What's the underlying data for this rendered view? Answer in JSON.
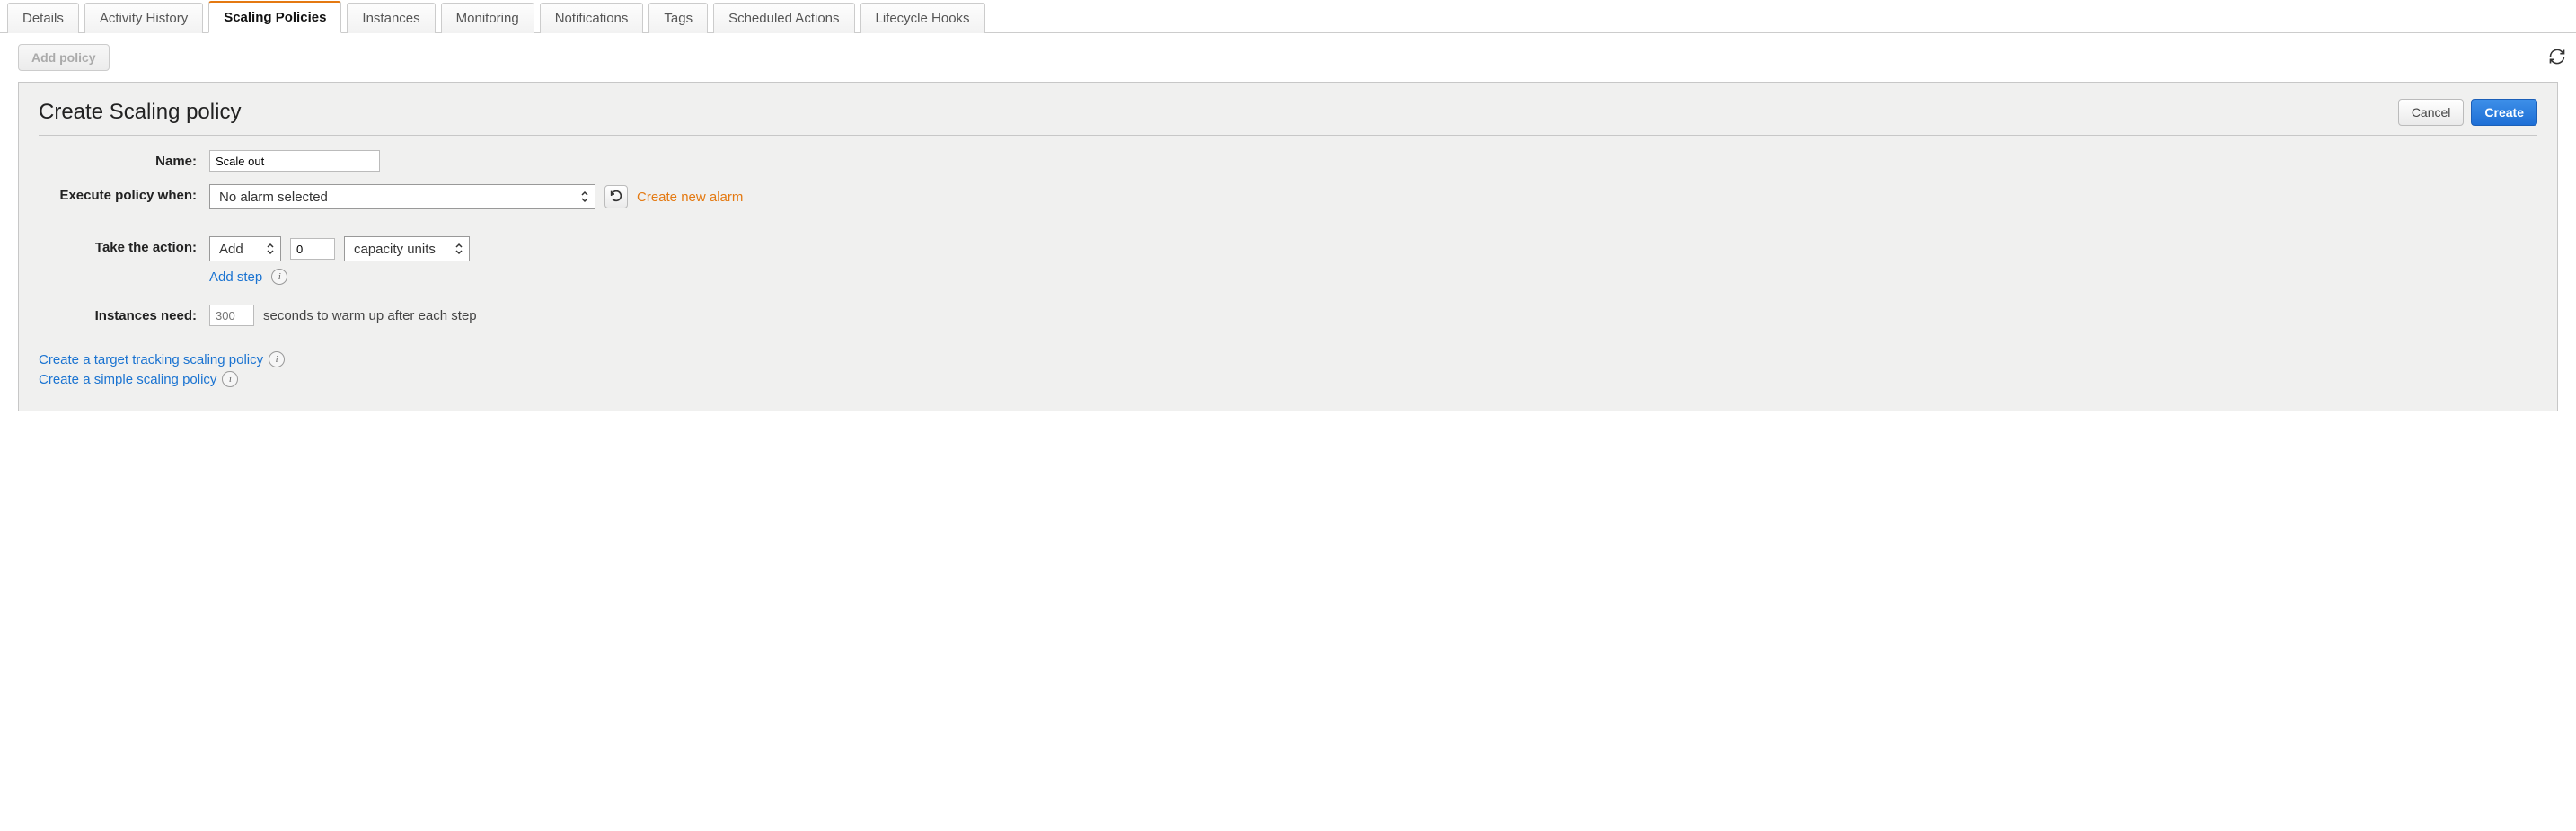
{
  "tabs": {
    "items": [
      {
        "label": "Details",
        "active": false
      },
      {
        "label": "Activity History",
        "active": false
      },
      {
        "label": "Scaling Policies",
        "active": true
      },
      {
        "label": "Instances",
        "active": false
      },
      {
        "label": "Monitoring",
        "active": false
      },
      {
        "label": "Notifications",
        "active": false
      },
      {
        "label": "Tags",
        "active": false
      },
      {
        "label": "Scheduled Actions",
        "active": false
      },
      {
        "label": "Lifecycle Hooks",
        "active": false
      }
    ]
  },
  "toolbar": {
    "add_policy_label": "Add policy"
  },
  "panel": {
    "title": "Create Scaling policy",
    "cancel_label": "Cancel",
    "create_label": "Create"
  },
  "form": {
    "name_label": "Name:",
    "name_value": "Scale out",
    "execute_label": "Execute policy when:",
    "alarm_selected": "No alarm selected",
    "create_alarm_link": "Create new alarm",
    "action_label": "Take the action:",
    "action_operator": "Add",
    "action_amount": "0",
    "action_unit": "capacity units",
    "add_step_link": "Add step",
    "warmup_label": "Instances need:",
    "warmup_placeholder": "300",
    "warmup_suffix": "seconds to warm up after each step"
  },
  "links": {
    "target_tracking": "Create a target tracking scaling policy",
    "simple_scaling": "Create a simple scaling policy"
  },
  "icons": {
    "info": "i"
  }
}
